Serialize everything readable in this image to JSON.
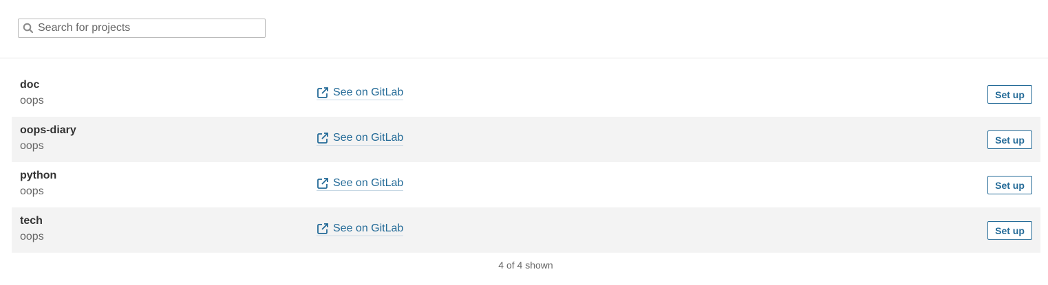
{
  "search": {
    "placeholder": "Search for projects"
  },
  "projects": [
    {
      "name": "doc",
      "org": "oops",
      "link_label": "See on GitLab",
      "action_label": "Set up"
    },
    {
      "name": "oops-diary",
      "org": "oops",
      "link_label": "See on GitLab",
      "action_label": "Set up"
    },
    {
      "name": "python",
      "org": "oops",
      "link_label": "See on GitLab",
      "action_label": "Set up"
    },
    {
      "name": "tech",
      "org": "oops",
      "link_label": "See on GitLab",
      "action_label": "Set up"
    }
  ],
  "footer": {
    "count_text": "4 of 4 shown"
  },
  "colors": {
    "link": "#236a97",
    "row_alt": "#f3f3f3",
    "muted_text": "#666666"
  },
  "icons": {
    "search": "search-icon",
    "external": "external-link-icon"
  }
}
